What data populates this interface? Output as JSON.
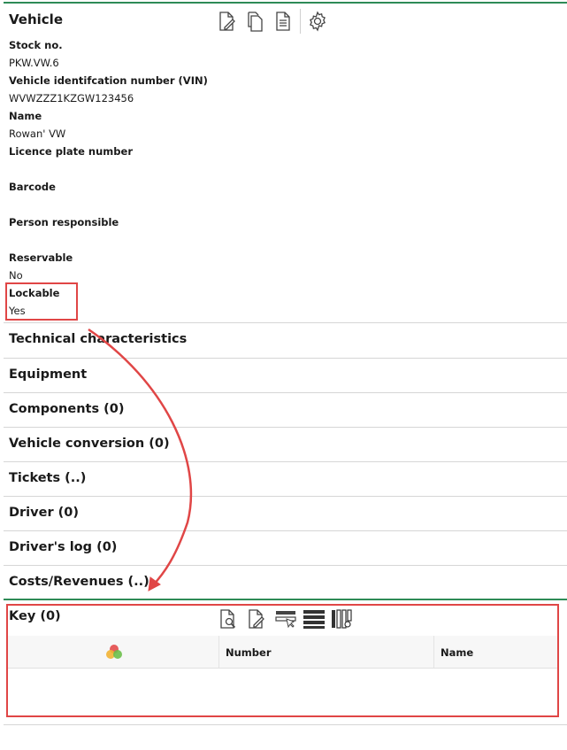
{
  "vehicle": {
    "title": "Vehicle",
    "fields": [
      {
        "label": "Stock no.",
        "value": "PKW.VW.6"
      },
      {
        "label": "Vehicle identifcation number (VIN)",
        "value": "WVWZZZ1KZGW123456"
      },
      {
        "label": "Name",
        "value": "Rowan' VW"
      },
      {
        "label": "Licence plate number",
        "value": ""
      },
      {
        "label": "Barcode",
        "value": ""
      },
      {
        "label": "Person responsible",
        "value": ""
      },
      {
        "label": "Reservable",
        "value": "No"
      },
      {
        "label": "Lockable",
        "value": "Yes"
      }
    ],
    "toolbar_icons": [
      "edit-document-icon",
      "copy-document-icon",
      "document-list-icon",
      "settings-gear-icon"
    ]
  },
  "sections": [
    {
      "label": "Technical characteristics"
    },
    {
      "label": "Equipment"
    },
    {
      "label": "Components (0)"
    },
    {
      "label": "Vehicle conversion (0)"
    },
    {
      "label": "Tickets (..)"
    },
    {
      "label": "Driver (0)"
    },
    {
      "label": "Driver's log (0)"
    },
    {
      "label": "Costs/Revenues (..)"
    }
  ],
  "key_panel": {
    "title": "Key (0)",
    "toolbar_icons": [
      "search-document-icon",
      "edit-document-icon",
      "select-row-icon",
      "list-view-icon",
      "column-settings-icon"
    ],
    "columns": [
      "",
      "Number",
      "Name"
    ],
    "rows": []
  },
  "colors": {
    "accent_green": "#2e8b57",
    "highlight_red": "#e04646"
  }
}
